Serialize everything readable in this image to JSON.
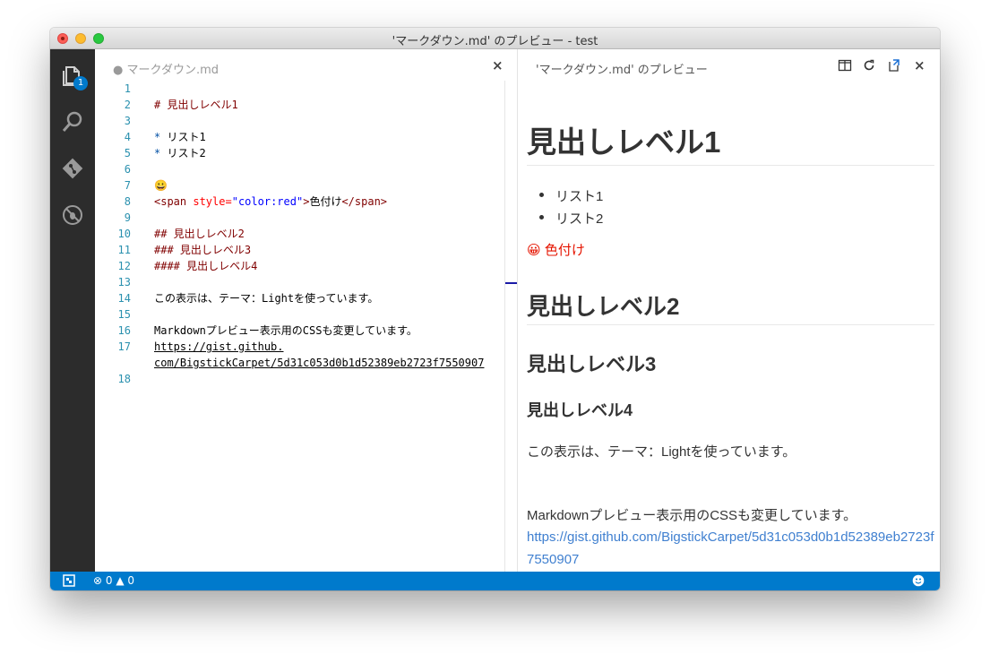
{
  "window": {
    "title": "'マークダウン.md' のプレビュー - test"
  },
  "activity": {
    "explorer_badge": "1"
  },
  "editor": {
    "tab_label": "● マークダウン.md",
    "lines": [
      {
        "n": "1",
        "text": ""
      },
      {
        "n": "2",
        "text": "# 見出しレベル1"
      },
      {
        "n": "3",
        "text": ""
      },
      {
        "n": "4",
        "bullet": "*",
        "text": " リスト1"
      },
      {
        "n": "5",
        "bullet": "*",
        "text": " リスト2"
      },
      {
        "n": "6",
        "text": ""
      },
      {
        "n": "7",
        "text": "😀"
      },
      {
        "n": "8",
        "tag_open": "<span ",
        "attr": "style=",
        "val": "\"color:red\"",
        "tag_close": ">",
        "inner": "色付け",
        "tag_end": "</span>"
      },
      {
        "n": "9",
        "text": ""
      },
      {
        "n": "10",
        "text": "## 見出しレベル2"
      },
      {
        "n": "11",
        "text": "### 見出しレベル3"
      },
      {
        "n": "12",
        "text": "#### 見出しレベル4"
      },
      {
        "n": "13",
        "text": ""
      },
      {
        "n": "14",
        "text": "この表示は、テーマ：Lightを使っています。"
      },
      {
        "n": "15",
        "text": ""
      },
      {
        "n": "16",
        "text": "Markdownプレビュー表示用のCSSも変更しています。"
      },
      {
        "n": "17",
        "link1": "https://gist.github.",
        "link2": "com/BigstickCarpet/5d31c053d0b1d52389eb2723f7550907"
      },
      {
        "n": "18",
        "text": ""
      }
    ]
  },
  "preview": {
    "tab_label": "'マークダウン.md' のプレビュー",
    "h1": "見出しレベル1",
    "list": [
      "リスト1",
      "リスト2"
    ],
    "emoji": "😀",
    "colored_text": "色付け",
    "h2": "見出しレベル2",
    "h3": "見出しレベル3",
    "h4": "見出しレベル4",
    "p1": "この表示は、テーマ：Lightを使っています。",
    "p2": "Markdownプレビュー表示用のCSSも変更しています。",
    "link": "https://gist.github.com/BigstickCarpet/5d31c053d0b1d52389eb2723f7550907"
  },
  "status": {
    "errors": "0",
    "warnings": "0"
  },
  "colors": {
    "accent": "#007acc",
    "activity_bar": "#2c2c2c",
    "red_text": "#e51400"
  }
}
